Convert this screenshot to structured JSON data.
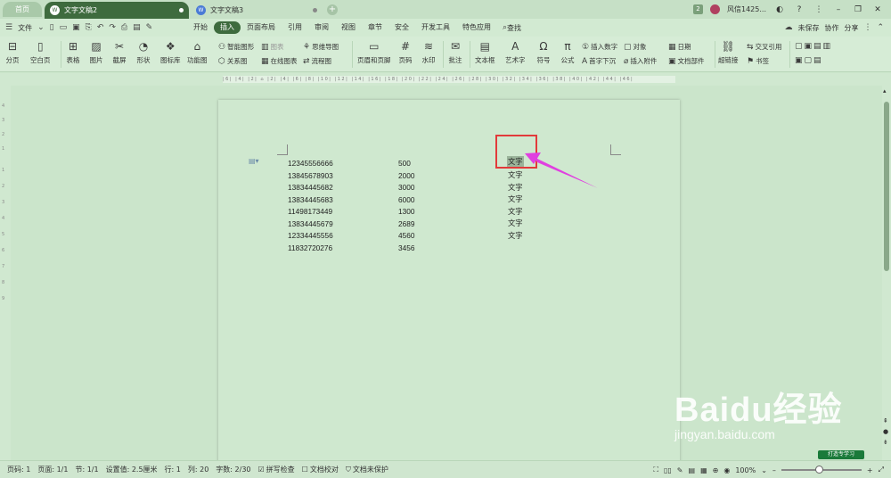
{
  "titlebar": {
    "home_tab": "首页",
    "tabs": [
      {
        "label": "文字文稿2",
        "active": true
      },
      {
        "label": "文字文稿3",
        "active": false
      }
    ],
    "add_tab": "+",
    "right": {
      "badge": "2",
      "user": "风信1425...",
      "min": "–",
      "restore": "❐",
      "close": "✕"
    }
  },
  "menubar": {
    "file": "文件",
    "tabs": [
      "开始",
      "插入",
      "页面布局",
      "引用",
      "审阅",
      "视图",
      "章节",
      "安全",
      "开发工具",
      "特色应用"
    ],
    "active_tab": "插入",
    "search": "查找",
    "unsaved": "未保存",
    "collab": "协作",
    "share": "分享"
  },
  "ribbon": {
    "big": [
      "分页",
      "空白页",
      "表格",
      "图片",
      "截屏",
      "形状",
      "图标库",
      "功能图",
      "页眉和页脚",
      "页码",
      "水印",
      "批注",
      "文本框",
      "艺术字",
      "符号",
      "公式",
      "超链接"
    ],
    "small": {
      "smart_art": "智能图形",
      "chart": "图表",
      "mind_map": "思维导图",
      "relation": "关系图",
      "online_chart": "在线图表",
      "flow_chart": "流程图",
      "insert_number": "插入数字",
      "object": "对象",
      "date": "日期",
      "drop_cap": "首字下沉",
      "attachment": "插入附件",
      "doc_part": "文档部件",
      "cross_ref": "交叉引用",
      "bookmark": "书签"
    }
  },
  "document": {
    "phones": [
      "12345556666",
      "13845678903",
      "13834445682",
      "13834445683",
      "11498173449",
      "13834445679",
      "12334445556",
      "11832720276"
    ],
    "amounts": [
      "500",
      "2000",
      "3000",
      "6000",
      "1300",
      "2689",
      "4560",
      "3456"
    ],
    "words": [
      "文字",
      "文字",
      "文字",
      "文字",
      "文字",
      "文字",
      "文字"
    ]
  },
  "watermark": {
    "logo": "Baidu经验",
    "url": "jingyan.baidu.com",
    "tag": "打造专学习"
  },
  "statusbar": {
    "page_num": "页码: 1",
    "page": "页面: 1/1",
    "section": "节: 1/1",
    "setting": "设置值: 2.5厘米",
    "row": "行: 1",
    "col": "列: 20",
    "words": "字数: 2/30",
    "spell": "拼写检查",
    "proof": "文档校对",
    "protect": "文档未保护",
    "zoom": "100%",
    "zoom_level": 0.47
  },
  "colors": {
    "accent": "#3e6b3e",
    "page_bg": "#cfe8cf",
    "highlight_border": "#e23a3a",
    "arrow": "#e040e0"
  }
}
